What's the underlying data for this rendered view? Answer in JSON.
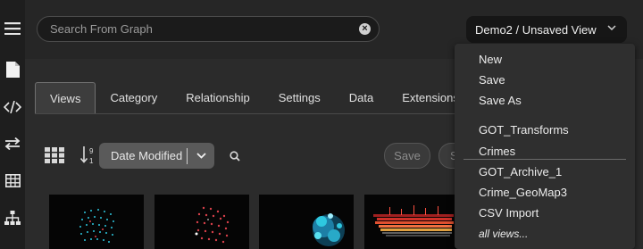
{
  "sidebar": {
    "items": [
      {
        "icon": "hamburger-menu-icon"
      },
      {
        "icon": "document-icon"
      },
      {
        "icon": "code-icon"
      },
      {
        "icon": "swap-arrows-icon"
      },
      {
        "icon": "table-icon"
      },
      {
        "icon": "hierarchy-icon"
      }
    ]
  },
  "search": {
    "placeholder": "Search From Graph"
  },
  "view_selector": {
    "label": "Demo2 / Unsaved View"
  },
  "tabs": [
    {
      "label": "Views",
      "active": true
    },
    {
      "label": "Category"
    },
    {
      "label": "Relationship"
    },
    {
      "label": "Settings"
    },
    {
      "label": "Data"
    },
    {
      "label": "Extensions"
    }
  ],
  "toolbar": {
    "sort_label": "Date Modified",
    "save_label": "Save",
    "save_as_partial": "Sa"
  },
  "menu": {
    "actions": [
      "New",
      "Save",
      "Save As"
    ],
    "views": [
      "GOT_Transforms",
      "Crimes",
      "GOT_Archive_1",
      "Crime_GeoMap3",
      "CSV Import"
    ],
    "more": "all views..."
  },
  "colors": {
    "accent_cyan": "#2ec8e0",
    "accent_red": "#e0404a",
    "sidebar_bg": "#1e1e1e",
    "menu_bg": "#2f2f2f"
  }
}
